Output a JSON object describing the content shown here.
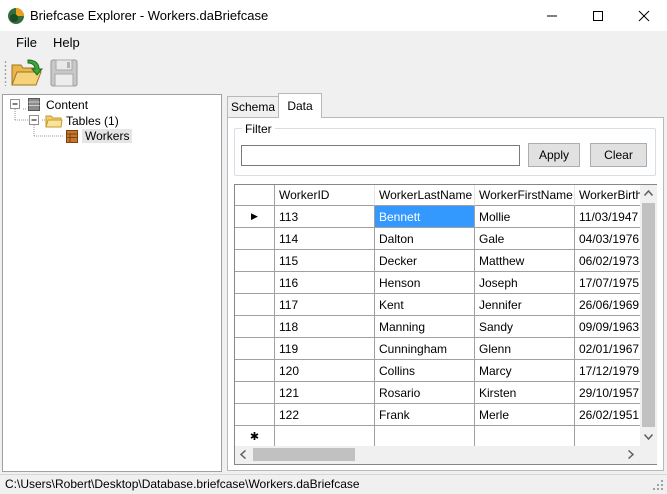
{
  "window": {
    "title": "Briefcase Explorer - Workers.daBriefcase",
    "controls": {
      "minimize_icon": "minimize-icon",
      "maximize_icon": "maximize-icon",
      "close_icon": "close-icon"
    }
  },
  "menu": {
    "file": "File",
    "help": "Help"
  },
  "toolbar": {
    "open_icon": "open-folder-icon",
    "save_icon": "save-disk-icon"
  },
  "tree": {
    "root": "Content",
    "tables": "Tables (1)",
    "table": "Workers"
  },
  "tabs": {
    "schema": "Schema",
    "data": "Data",
    "active": "Data"
  },
  "filter": {
    "legend": "Filter",
    "value": "",
    "apply": "Apply",
    "clear": "Clear"
  },
  "grid": {
    "columns": [
      "WorkerID",
      "WorkerLastName",
      "WorkerFirstName",
      "WorkerBirthI"
    ],
    "rows": [
      [
        "113",
        "Bennett",
        "Mollie",
        "11/03/1947"
      ],
      [
        "114",
        "Dalton",
        "Gale",
        "04/03/1976"
      ],
      [
        "115",
        "Decker",
        "Matthew",
        "06/02/1973"
      ],
      [
        "116",
        "Henson",
        "Joseph",
        "17/07/1975"
      ],
      [
        "117",
        "Kent",
        "Jennifer",
        "26/06/1969"
      ],
      [
        "118",
        "Manning",
        "Sandy",
        "09/09/1963"
      ],
      [
        "119",
        "Cunningham",
        "Glenn",
        "02/01/1967"
      ],
      [
        "120",
        "Collins",
        "Marcy",
        "17/12/1979"
      ],
      [
        "121",
        "Rosario",
        "Kirsten",
        "29/10/1957"
      ],
      [
        "122",
        "Frank",
        "Merle",
        "26/02/1951"
      ]
    ],
    "current_row_marker": "▶",
    "new_row_marker": "✱",
    "selected_cell": {
      "row": 0,
      "col": 1
    }
  },
  "status": {
    "path": "C:\\Users\\Robert\\Desktop\\Database.briefcase\\Workers.daBriefcase"
  },
  "colors": {
    "selection": "#3399ff",
    "window_bg": "#f0f0f0",
    "grid_line": "#a0a0a0"
  }
}
